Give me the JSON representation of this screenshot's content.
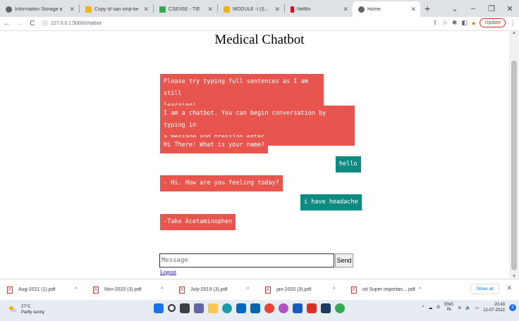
{
  "browser": {
    "tabs": [
      {
        "label": "Information Storage a",
        "color": "#5f6368"
      },
      {
        "label": "Copy of san smp-tie",
        "color": "#f4b400"
      },
      {
        "label": "CSE/ISE - TIE",
        "color": "#34a853"
      },
      {
        "label": "MODULE -I (SAN).pdf",
        "color": "#f4b400"
      },
      {
        "label": "Netflix",
        "color": "#e50914"
      },
      {
        "label": "Home",
        "color": "#5f6368"
      }
    ],
    "url": "127.0.0.1:5000/chatbot",
    "update_label": "Update"
  },
  "page": {
    "title": "Medical Chatbot",
    "messages": [
      {
        "role": "bot",
        "text": "Please try typing full sentences as I am still\nlearning!"
      },
      {
        "role": "bot",
        "text": "I am a chatbot. You can begin conversation by typing in\na message and pressing enter."
      },
      {
        "role": "bot",
        "text": "Hi There! What is your name?"
      },
      {
        "role": "user",
        "text": "hello"
      },
      {
        "role": "bot",
        "text": "- Hi. How are you feeling today?"
      },
      {
        "role": "user",
        "text": "i have headache"
      },
      {
        "role": "bot",
        "text": "-Take Acetaminophen"
      }
    ],
    "input_placeholder": "Message",
    "send_label": "Send",
    "logout_label": "Logout"
  },
  "downloads": {
    "items": [
      "Aug-2021 (1).pdf",
      "Nov-2020 (3).pdf",
      "July-2019 (3).pdf",
      "jan-2020 (3).pdf",
      "iot Super importan....pdf"
    ],
    "show_all_label": "Show all"
  },
  "taskbar": {
    "weather_temp": "27°C",
    "weather_text": "Partly sunny",
    "lang_line1": "ENG",
    "lang_line2": "IN",
    "time": "20:43",
    "date": "12-07-2022"
  },
  "colors": {
    "bot_bubble": "#e8554e",
    "user_bubble": "#0e8b80"
  }
}
